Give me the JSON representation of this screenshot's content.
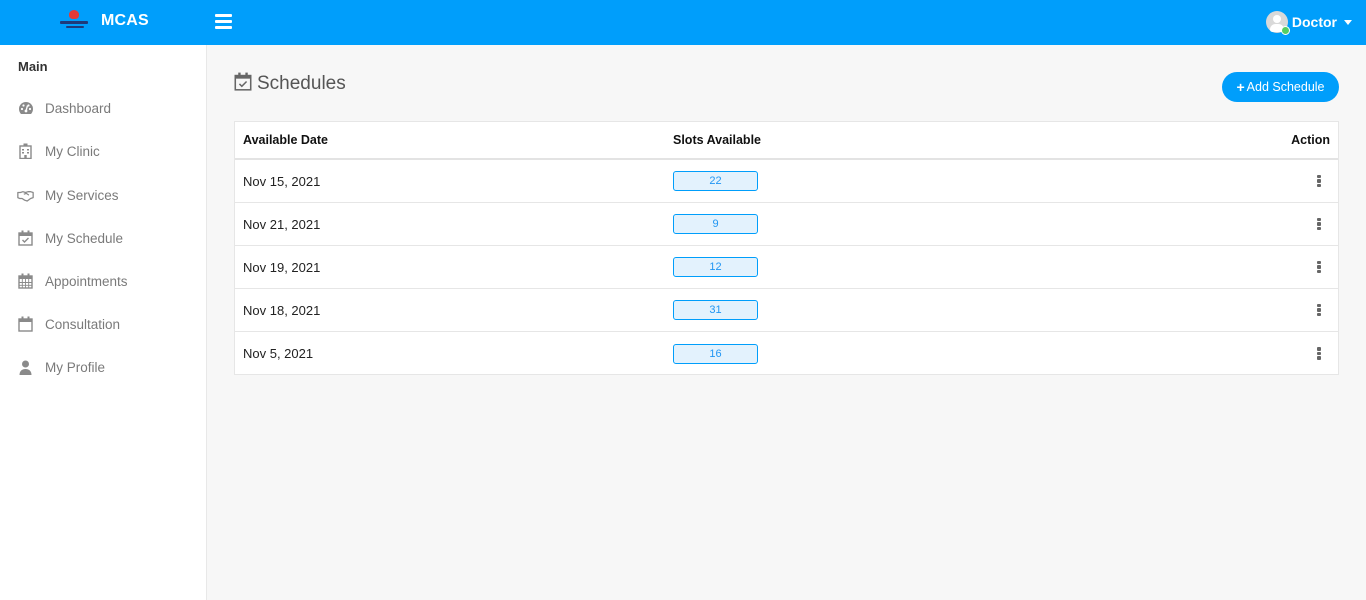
{
  "header": {
    "brand": "MCAS",
    "user_name": "Doctor",
    "colors": {
      "primary": "#009efb",
      "online": "#55ce63"
    }
  },
  "sidebar": {
    "section_title": "Main",
    "items": [
      {
        "label": "Dashboard",
        "icon": "dashboard-icon"
      },
      {
        "label": "My Clinic",
        "icon": "hospital-icon"
      },
      {
        "label": "My Services",
        "icon": "handshake-icon"
      },
      {
        "label": "My Schedule",
        "icon": "calendar-check-icon"
      },
      {
        "label": "Appointments",
        "icon": "calendar-grid-icon"
      },
      {
        "label": "Consultation",
        "icon": "calendar-icon"
      },
      {
        "label": "My Profile",
        "icon": "user-icon"
      }
    ]
  },
  "main": {
    "title": "Schedules",
    "add_button_label": "Add Schedule",
    "table": {
      "columns": [
        "Available Date",
        "Slots Available",
        "Action"
      ],
      "rows": [
        {
          "date": "Nov 15, 2021",
          "slots": "22"
        },
        {
          "date": "Nov 21, 2021",
          "slots": "9"
        },
        {
          "date": "Nov 19, 2021",
          "slots": "12"
        },
        {
          "date": "Nov 18, 2021",
          "slots": "31"
        },
        {
          "date": "Nov 5, 2021",
          "slots": "16"
        }
      ]
    }
  }
}
